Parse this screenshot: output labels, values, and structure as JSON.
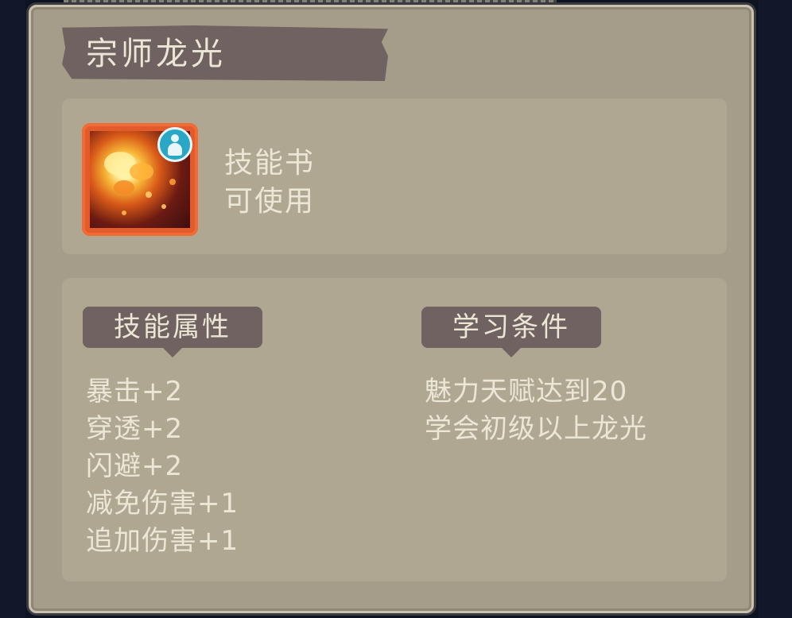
{
  "title": "宗师龙光",
  "item": {
    "icon": "dragon-fire-skill-icon",
    "badge_icon": "person-badge-icon",
    "type_label": "技能书",
    "usable_label": "可使用"
  },
  "sections": {
    "attributes_tag": "技能属性",
    "requirements_tag": "学习条件"
  },
  "attributes": [
    "暴击+2",
    "穿透+2",
    "闪避+2",
    "减免伤害+1",
    "追加伤害+1"
  ],
  "requirements": [
    "魅力天赋达到20",
    "学会初级以上龙光"
  ],
  "colors": {
    "panel_bg": "#a59c89",
    "box_bg": "#b0a793",
    "tag_bg": "#6f6260",
    "text": "#ece6d6",
    "icon_frame": "#f06b35",
    "badge": "#29a7c6"
  }
}
